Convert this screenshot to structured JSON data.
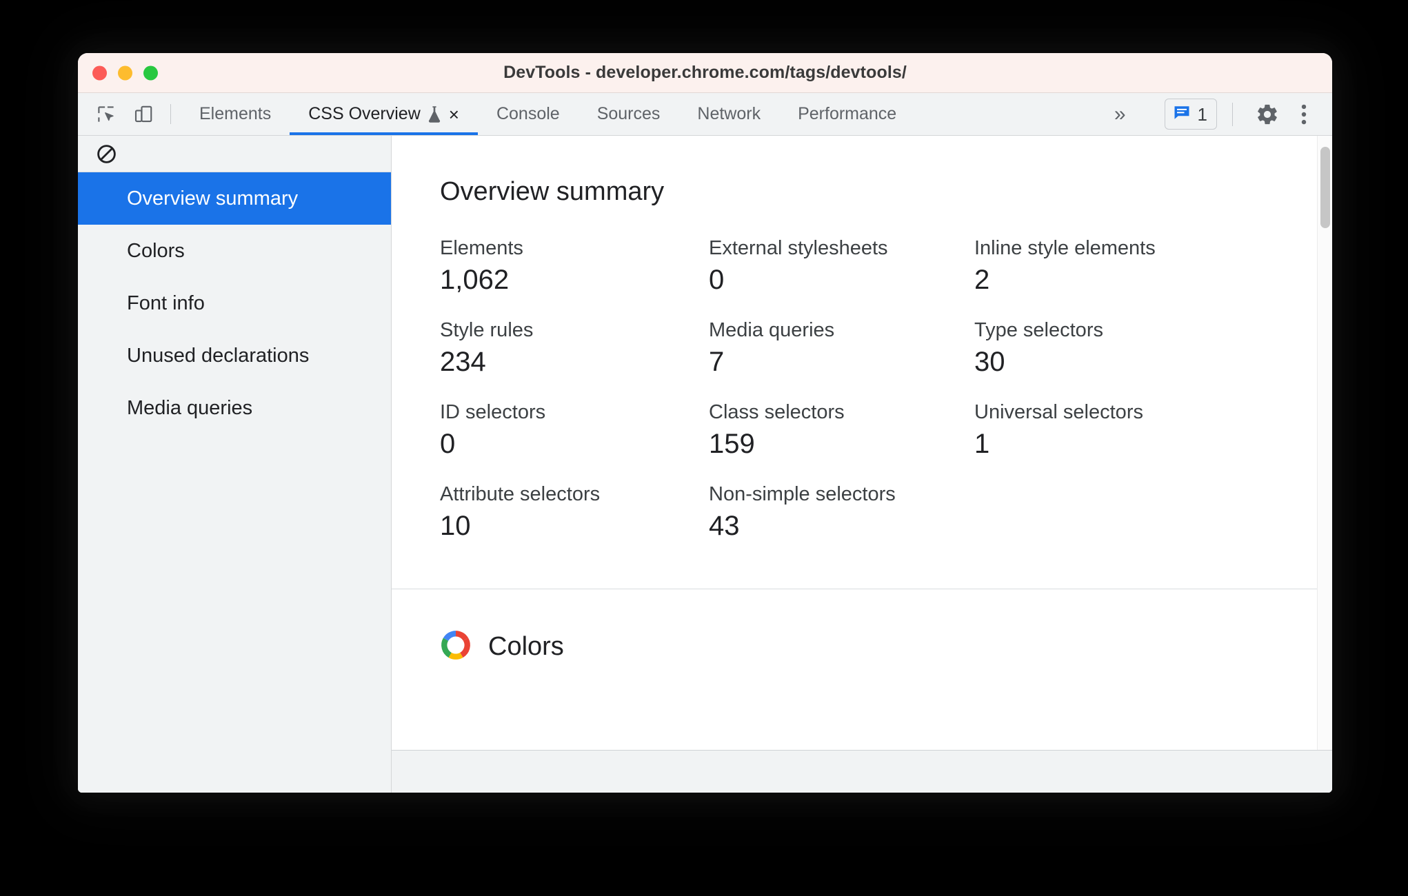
{
  "window": {
    "title": "DevTools - developer.chrome.com/tags/devtools/",
    "traffic_lights": [
      "close",
      "minimize",
      "maximize"
    ],
    "colors": {
      "titlebar_bg": "#fcf1ee",
      "toolbar_bg": "#f1f3f4",
      "accent": "#1a73e8",
      "close_light": "#fc5b57",
      "minimize_light": "#fdbc2e",
      "maximize_light": "#28c840"
    }
  },
  "toolbar": {
    "inspect_icon": "inspect-element-icon",
    "device_icon": "device-toolbar-icon",
    "tabs": [
      {
        "label": "Elements",
        "active": false,
        "closable": false,
        "experimental": false
      },
      {
        "label": "CSS Overview",
        "active": true,
        "closable": true,
        "experimental": true
      },
      {
        "label": "Console",
        "active": false,
        "closable": false,
        "experimental": false
      },
      {
        "label": "Sources",
        "active": false,
        "closable": false,
        "experimental": false
      },
      {
        "label": "Network",
        "active": false,
        "closable": false,
        "experimental": false
      },
      {
        "label": "Performance",
        "active": false,
        "closable": false,
        "experimental": false
      }
    ],
    "more_tabs_label": "»",
    "close_tab_label": "×",
    "message_count": "1",
    "message_icon": "message-icon",
    "settings_icon": "gear-icon",
    "menu_icon": "vertical-dots-icon"
  },
  "sidebar": {
    "clear_icon": "clear-icon",
    "items": [
      {
        "label": "Overview summary",
        "selected": true
      },
      {
        "label": "Colors",
        "selected": false
      },
      {
        "label": "Font info",
        "selected": false
      },
      {
        "label": "Unused declarations",
        "selected": false
      },
      {
        "label": "Media queries",
        "selected": false
      }
    ]
  },
  "main": {
    "summary_title": "Overview summary",
    "stats": [
      {
        "label": "Elements",
        "value": "1,062"
      },
      {
        "label": "External stylesheets",
        "value": "0"
      },
      {
        "label": "Inline style elements",
        "value": "2"
      },
      {
        "label": "Style rules",
        "value": "234"
      },
      {
        "label": "Media queries",
        "value": "7"
      },
      {
        "label": "Type selectors",
        "value": "30"
      },
      {
        "label": "ID selectors",
        "value": "0"
      },
      {
        "label": "Class selectors",
        "value": "159"
      },
      {
        "label": "Universal selectors",
        "value": "1"
      },
      {
        "label": "Attribute selectors",
        "value": "10"
      },
      {
        "label": "Non-simple selectors",
        "value": "43"
      },
      {
        "label": "",
        "value": ""
      }
    ],
    "colors_section": {
      "title": "Colors",
      "icon": "color-wheel-icon",
      "wheel_colors": [
        "#4285f4",
        "#ea4335",
        "#fbbc04",
        "#34a853"
      ]
    }
  }
}
